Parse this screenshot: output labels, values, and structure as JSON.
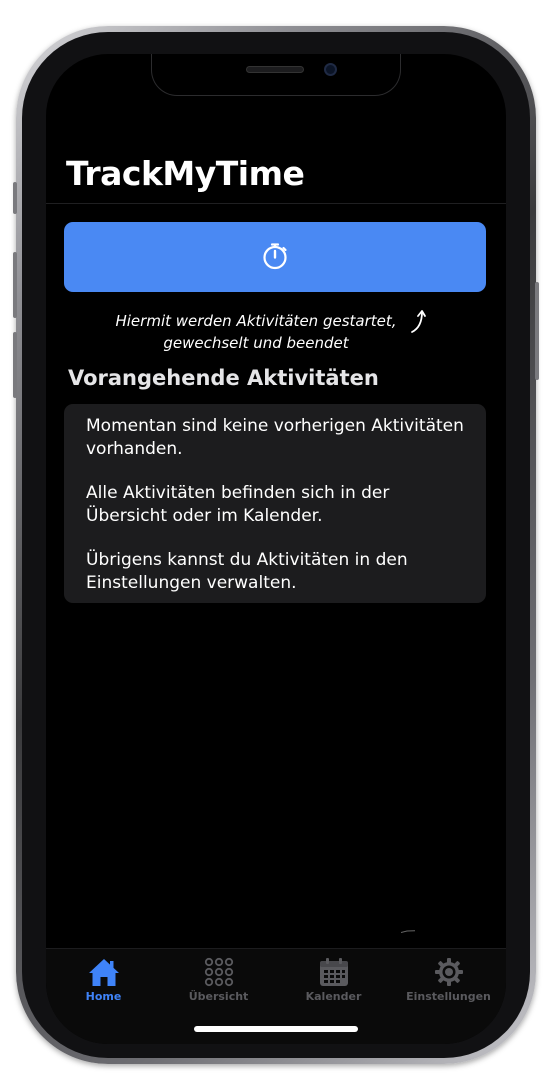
{
  "app": {
    "title": "TrackMyTime"
  },
  "start_button": {
    "icon": "stopwatch-icon",
    "color": "#4a89f3"
  },
  "hint": {
    "line1": "Hiermit werden Aktivitäten gestartet,",
    "line2": "gewechselt und beendet"
  },
  "previous_activities": {
    "title": "Vorangehende Aktivitäten",
    "messages": [
      "Momentan sind keine vorherigen Aktivitäten vorhanden.",
      "Alle Aktivitäten befinden sich in der Übersicht oder im Kalender.",
      "Übrigens kannst du Aktivitäten in den Einstellungen verwalten."
    ]
  },
  "tab_bar": {
    "tabs": [
      {
        "label": "Home",
        "icon": "home-icon",
        "active": true
      },
      {
        "label": "Übersicht",
        "icon": "grid-dots-icon",
        "active": false
      },
      {
        "label": "Kalender",
        "icon": "calendar-icon",
        "active": false
      },
      {
        "label": "Einstellungen",
        "icon": "gear-icon",
        "active": false
      }
    ],
    "active_color": "#3f83f8",
    "inactive_color": "#5a5a5e"
  }
}
